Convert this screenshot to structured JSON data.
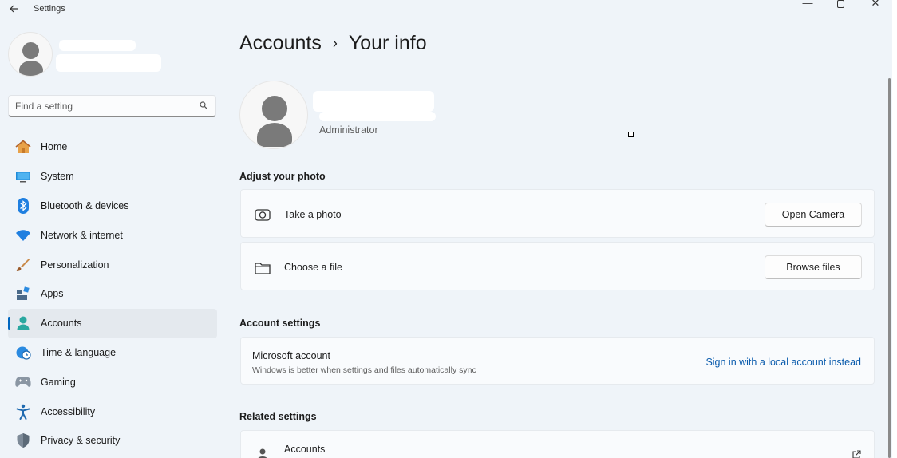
{
  "window": {
    "title": "Settings",
    "back_icon": "back-arrow-icon",
    "controls": [
      "minimize-icon",
      "maximize-icon",
      "close-icon"
    ]
  },
  "search": {
    "placeholder": "Find a setting",
    "value": ""
  },
  "sidebar": {
    "items": [
      {
        "label": "Home",
        "icon": "home-icon",
        "active": false
      },
      {
        "label": "System",
        "icon": "system-icon",
        "active": false
      },
      {
        "label": "Bluetooth & devices",
        "icon": "bluetooth-icon",
        "active": false
      },
      {
        "label": "Network & internet",
        "icon": "wifi-icon",
        "active": false
      },
      {
        "label": "Personalization",
        "icon": "paintbrush-icon",
        "active": false
      },
      {
        "label": "Apps",
        "icon": "apps-icon",
        "active": false
      },
      {
        "label": "Accounts",
        "icon": "person-icon",
        "active": true
      },
      {
        "label": "Time & language",
        "icon": "globe-clock-icon",
        "active": false
      },
      {
        "label": "Gaming",
        "icon": "gamepad-icon",
        "active": false
      },
      {
        "label": "Accessibility",
        "icon": "accessibility-icon",
        "active": false
      },
      {
        "label": "Privacy & security",
        "icon": "shield-icon",
        "active": false
      }
    ]
  },
  "header": {
    "parent": "Accounts",
    "separator": "›",
    "current": "Your info"
  },
  "profile": {
    "role": "Administrator"
  },
  "adjust_photo": {
    "title": "Adjust your photo",
    "take_photo_label": "Take a photo",
    "open_camera_label": "Open Camera",
    "choose_file_label": "Choose a file",
    "browse_files_label": "Browse files"
  },
  "account_settings": {
    "title": "Account settings",
    "microsoft_account_title": "Microsoft account",
    "microsoft_account_subtitle": "Windows is better when settings and files automatically sync",
    "sign_in_local_link": "Sign in with a local account instead"
  },
  "related_settings": {
    "title": "Related settings",
    "items": [
      {
        "label": "Accounts",
        "icon": "person-icon",
        "external_icon": "open-external-icon"
      }
    ]
  },
  "colors": {
    "accent": "#0067c0",
    "link": "#0b5cad",
    "background": "#eff4f9",
    "card": "#f9fbfd"
  }
}
